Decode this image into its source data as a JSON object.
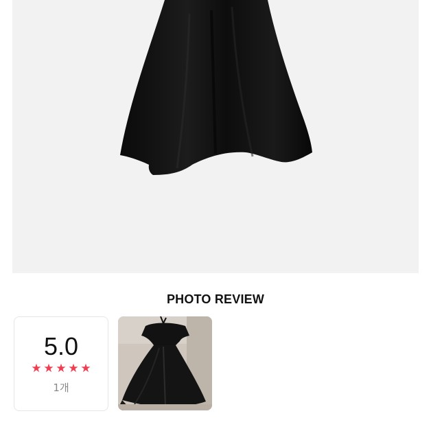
{
  "product": {
    "image_alt_icon": "black-skirt-image"
  },
  "photo_review": {
    "title": "PHOTO REVIEW",
    "rating": {
      "score": "5.0",
      "stars": [
        "★",
        "★",
        "★",
        "★",
        "★"
      ],
      "star_count": 5,
      "count": "1개"
    },
    "photos": [
      {
        "icon": "black-dress-photo"
      }
    ]
  },
  "colors": {
    "star": "#ee3f52",
    "panel_bg": "#f2f2f2",
    "text": "#111111",
    "muted": "#888888"
  }
}
